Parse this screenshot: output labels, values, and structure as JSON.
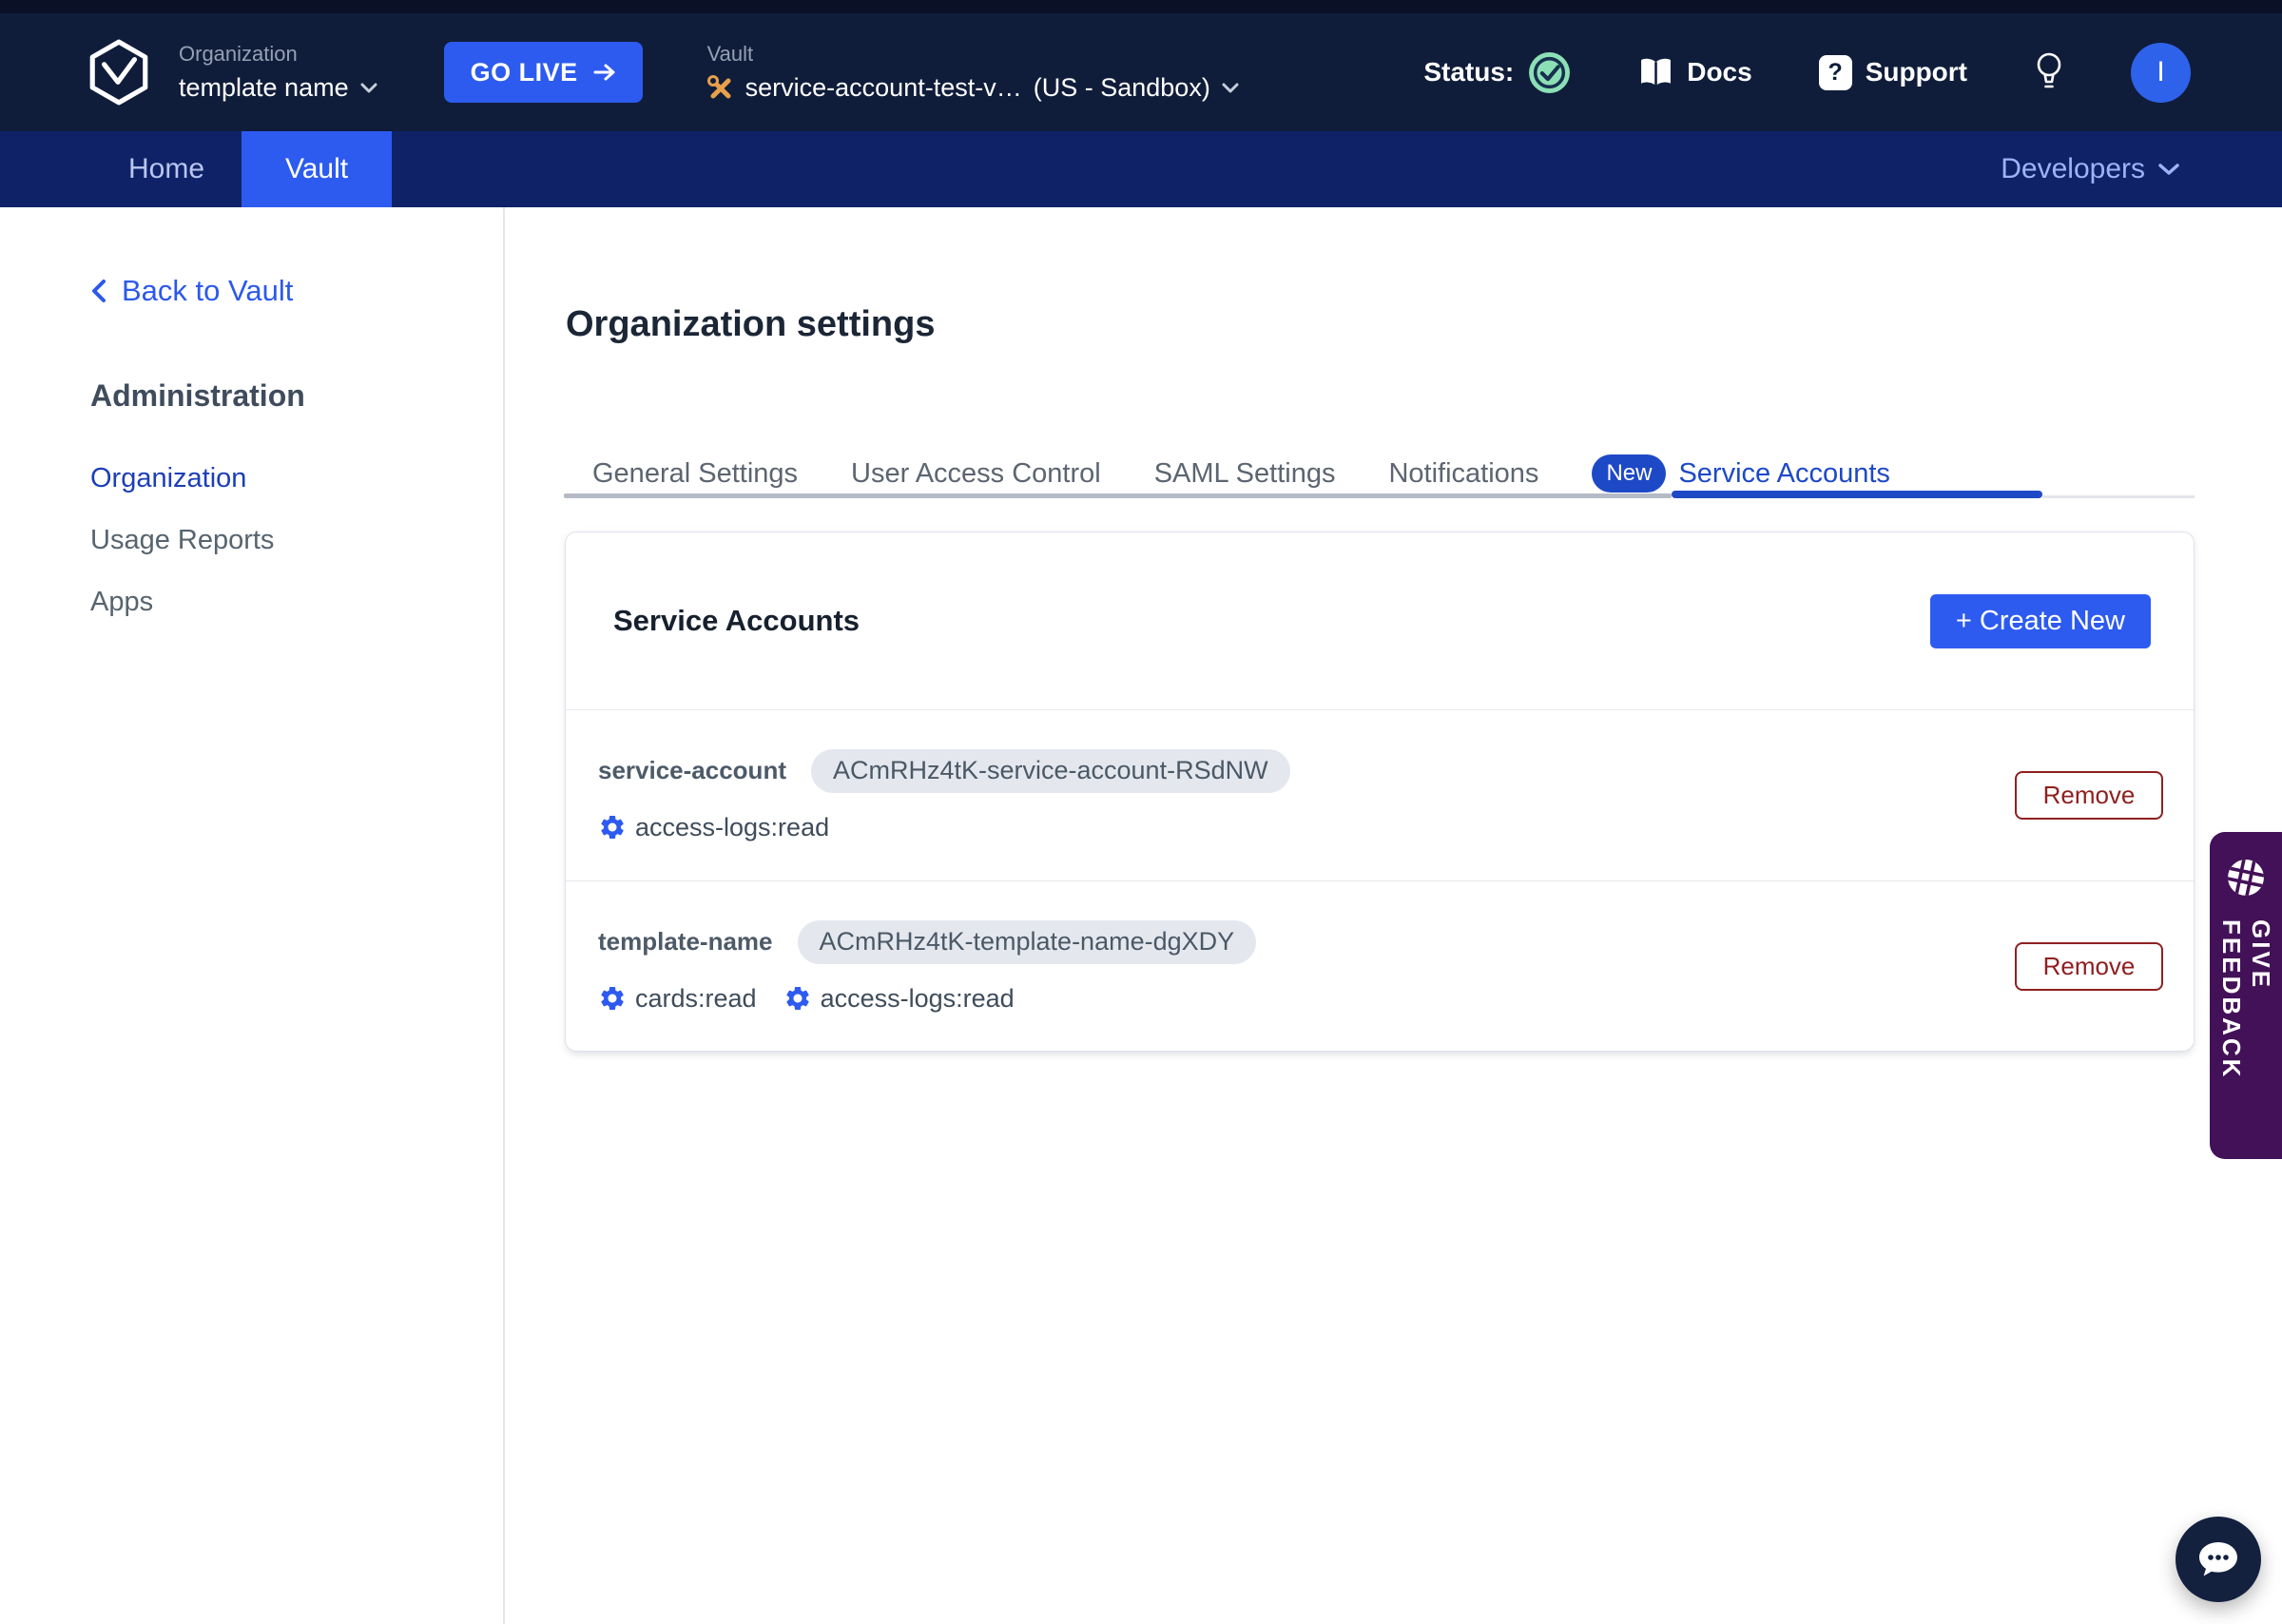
{
  "colors": {
    "accent": "#2d5bf0",
    "header_bg": "#101d3a",
    "nav_bg": "#0f2268",
    "tab_active": "#1e49c6",
    "link_blue": "#2c59e9",
    "remove_red": "#8f2020",
    "feedback_purple": "#431158",
    "status_green": "#8ce0b5",
    "sandbox_orange": "#e8a04c",
    "pill_bg": "#e4e8ee"
  },
  "header": {
    "org_label": "Organization",
    "org_name": "template name",
    "go_live_label": "GO LIVE",
    "vault_label": "Vault",
    "vault_name": "service-account-test-v…",
    "vault_region": "(US - Sandbox)",
    "status_label": "Status:",
    "docs_label": "Docs",
    "support_label": "Support",
    "support_icon": "?",
    "avatar_letter": "I"
  },
  "nav": {
    "items": [
      {
        "label": "Home",
        "active": false
      },
      {
        "label": "Vault",
        "active": true
      }
    ],
    "developers_label": "Developers"
  },
  "sidebar": {
    "back_link": "Back to Vault",
    "section_title": "Administration",
    "items": [
      {
        "label": "Organization",
        "active": true
      },
      {
        "label": "Usage Reports",
        "active": false
      },
      {
        "label": "Apps",
        "active": false
      }
    ]
  },
  "main": {
    "page_title": "Organization settings",
    "tabs": [
      {
        "label": "General Settings",
        "active": false
      },
      {
        "label": "User Access Control",
        "active": false
      },
      {
        "label": "SAML Settings",
        "active": false
      },
      {
        "label": "Notifications",
        "active": false
      },
      {
        "label": "Service Accounts",
        "active": true,
        "badge": "New"
      }
    ],
    "card": {
      "title": "Service Accounts",
      "create_button": "+ Create New",
      "remove_button": "Remove",
      "accounts": [
        {
          "name": "service-account",
          "token": "ACmRHz4tK-service-account-RSdNW",
          "scopes": [
            "access-logs:read"
          ]
        },
        {
          "name": "template-name",
          "token": "ACmRHz4tK-template-name-dgXDY",
          "scopes": [
            "cards:read",
            "access-logs:read"
          ]
        }
      ]
    }
  },
  "feedback": {
    "label": "GIVE FEEDBACK"
  }
}
